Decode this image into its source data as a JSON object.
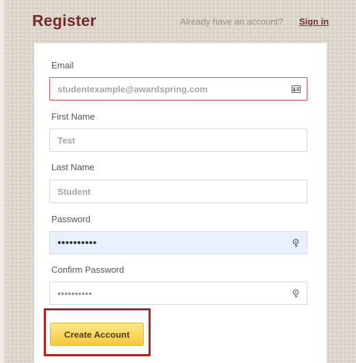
{
  "header": {
    "title": "Register",
    "already_text": "Already have an account?",
    "signin_label": "Sign in"
  },
  "form": {
    "email": {
      "label": "Email",
      "value": "studentexample@awardspring.com",
      "icon": "contact-card-icon",
      "state": "error"
    },
    "first_name": {
      "label": "First Name",
      "value": "Test"
    },
    "last_name": {
      "label": "Last Name",
      "value": "Student"
    },
    "password": {
      "label": "Password",
      "value": "••••••••••",
      "icon": "key-icon",
      "state": "autofilled"
    },
    "confirm_password": {
      "label": "Confirm Password",
      "value": "••••••••••",
      "icon": "key-icon"
    },
    "submit_label": "Create Account"
  },
  "colors": {
    "brand": "#7a2a2a",
    "error_border": "#d65252",
    "autofill_bg": "#e8f0fe",
    "button": "#f6c93a",
    "highlight": "#b01e1e"
  }
}
